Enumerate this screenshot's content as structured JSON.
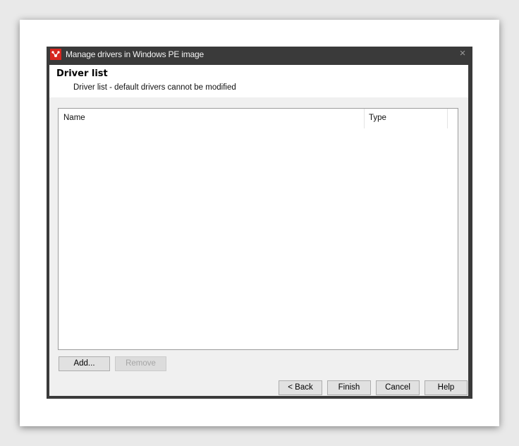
{
  "dialog": {
    "title": "Manage drivers in Windows PE image",
    "close_glyph": "×"
  },
  "header": {
    "title": "Driver list",
    "subtitle": "Driver list - default drivers cannot be modified"
  },
  "list": {
    "columns": [
      "Name",
      "Type"
    ],
    "rows": []
  },
  "buttons": {
    "add": "Add...",
    "remove": "Remove",
    "back": "< Back",
    "finish": "Finish",
    "cancel": "Cancel",
    "help": "Help"
  },
  "icons": {
    "app": "app-logo-icon",
    "close": "close-icon"
  },
  "colors": {
    "titlebar": "#3a3a3a",
    "app_icon_bg": "#d7261e",
    "client_bg": "#f0f0f0"
  }
}
